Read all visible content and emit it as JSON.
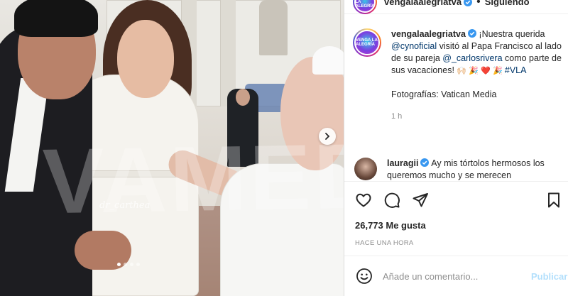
{
  "post": {
    "username": "vengalaalegriatva",
    "avatar_text": "VENGA LA ALEGRÍA",
    "follow_label": "Siguiendo",
    "caption": {
      "username": "vengalaalegriatva",
      "text_1": "¡Nuestra querida",
      "mention_1": "@cynoficial",
      "text_2": " visitó al Papa Francisco al lado de su pareja ",
      "mention_2": "@_carlosrivera",
      "text_3": " como parte de sus vacaciones! ",
      "emojis_1": "🙌🏻 🎉",
      "emojis_2": "❤️ 🎉 ",
      "hashtag": "#VLA",
      "photo_credit": "Fotografías: Vatican Media",
      "time": "1 h"
    },
    "comment": {
      "username": "lauragii",
      "text": "Ay mis tórtolos hermosos los queremos mucho y se merecen"
    },
    "likes": "26,773 Me gusta",
    "posted": "HACE UNA HORA",
    "add_comment_placeholder": "Añade un comentario...",
    "post_button": "Publicar"
  },
  "image": {
    "watermark": "VAMEDIA",
    "signature": "dr_carthea"
  },
  "icons": {
    "like": "heart-icon",
    "comment": "comment-icon",
    "share": "paper-plane-icon",
    "save": "bookmark-icon",
    "emoji": "smiley-icon",
    "next": "chevron-right-icon",
    "verified": "verified-badge-icon"
  },
  "colors": {
    "accent": "#0095f6",
    "verified": "#3897f0",
    "link": "#00376b",
    "muted": "#8e8e8e"
  }
}
